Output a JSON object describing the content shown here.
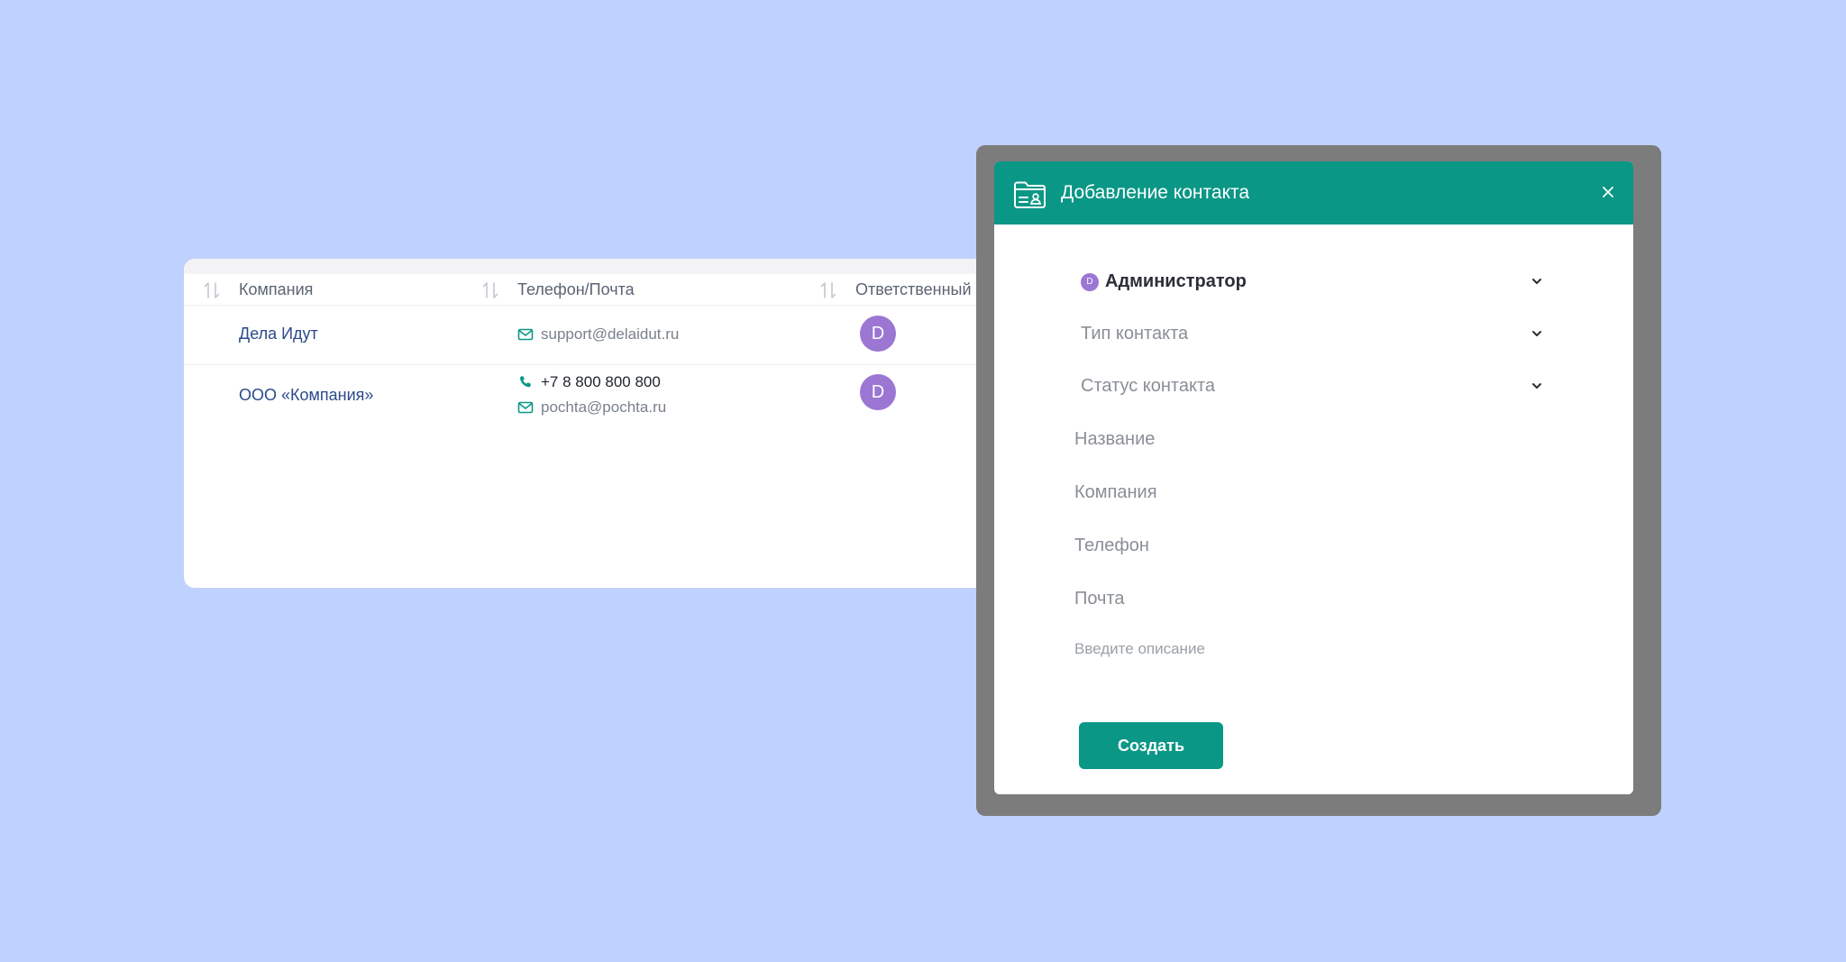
{
  "colors": {
    "background": "#bfd1fd",
    "accent": "#0b9786",
    "link": "#2b4a8a",
    "avatar": "#9b76d3",
    "backdrop": "#7c7c7c"
  },
  "table": {
    "columns": [
      {
        "label": "Компания",
        "sort_icon": "sort-icon"
      },
      {
        "label": "Телефон/Почта",
        "sort_icon": "sort-icon"
      },
      {
        "label": "Ответственный",
        "sort_icon": "sort-icon"
      }
    ],
    "rows": [
      {
        "company": "Дела Идут",
        "email": "support@delaidut.ru",
        "phone": "",
        "responsible_initial": "D"
      },
      {
        "company": "ООО «Компания»",
        "phone": "+7 8 800 800 800",
        "email": "pochta@pochta.ru",
        "responsible_initial": "D"
      }
    ]
  },
  "modal": {
    "title": "Добавление контакта",
    "header_icon": "contact-folder-icon",
    "close_icon": "close-icon",
    "responsible": {
      "initial": "D",
      "label": "Администратор"
    },
    "contact_type_label": "Тип контакта",
    "contact_status_label": "Статус контакта",
    "fields": {
      "name_placeholder": "Название",
      "company_placeholder": "Компания",
      "phone_placeholder": "Телефон",
      "email_placeholder": "Почта",
      "description_placeholder": "Введите описание"
    },
    "create_label": "Создать"
  }
}
